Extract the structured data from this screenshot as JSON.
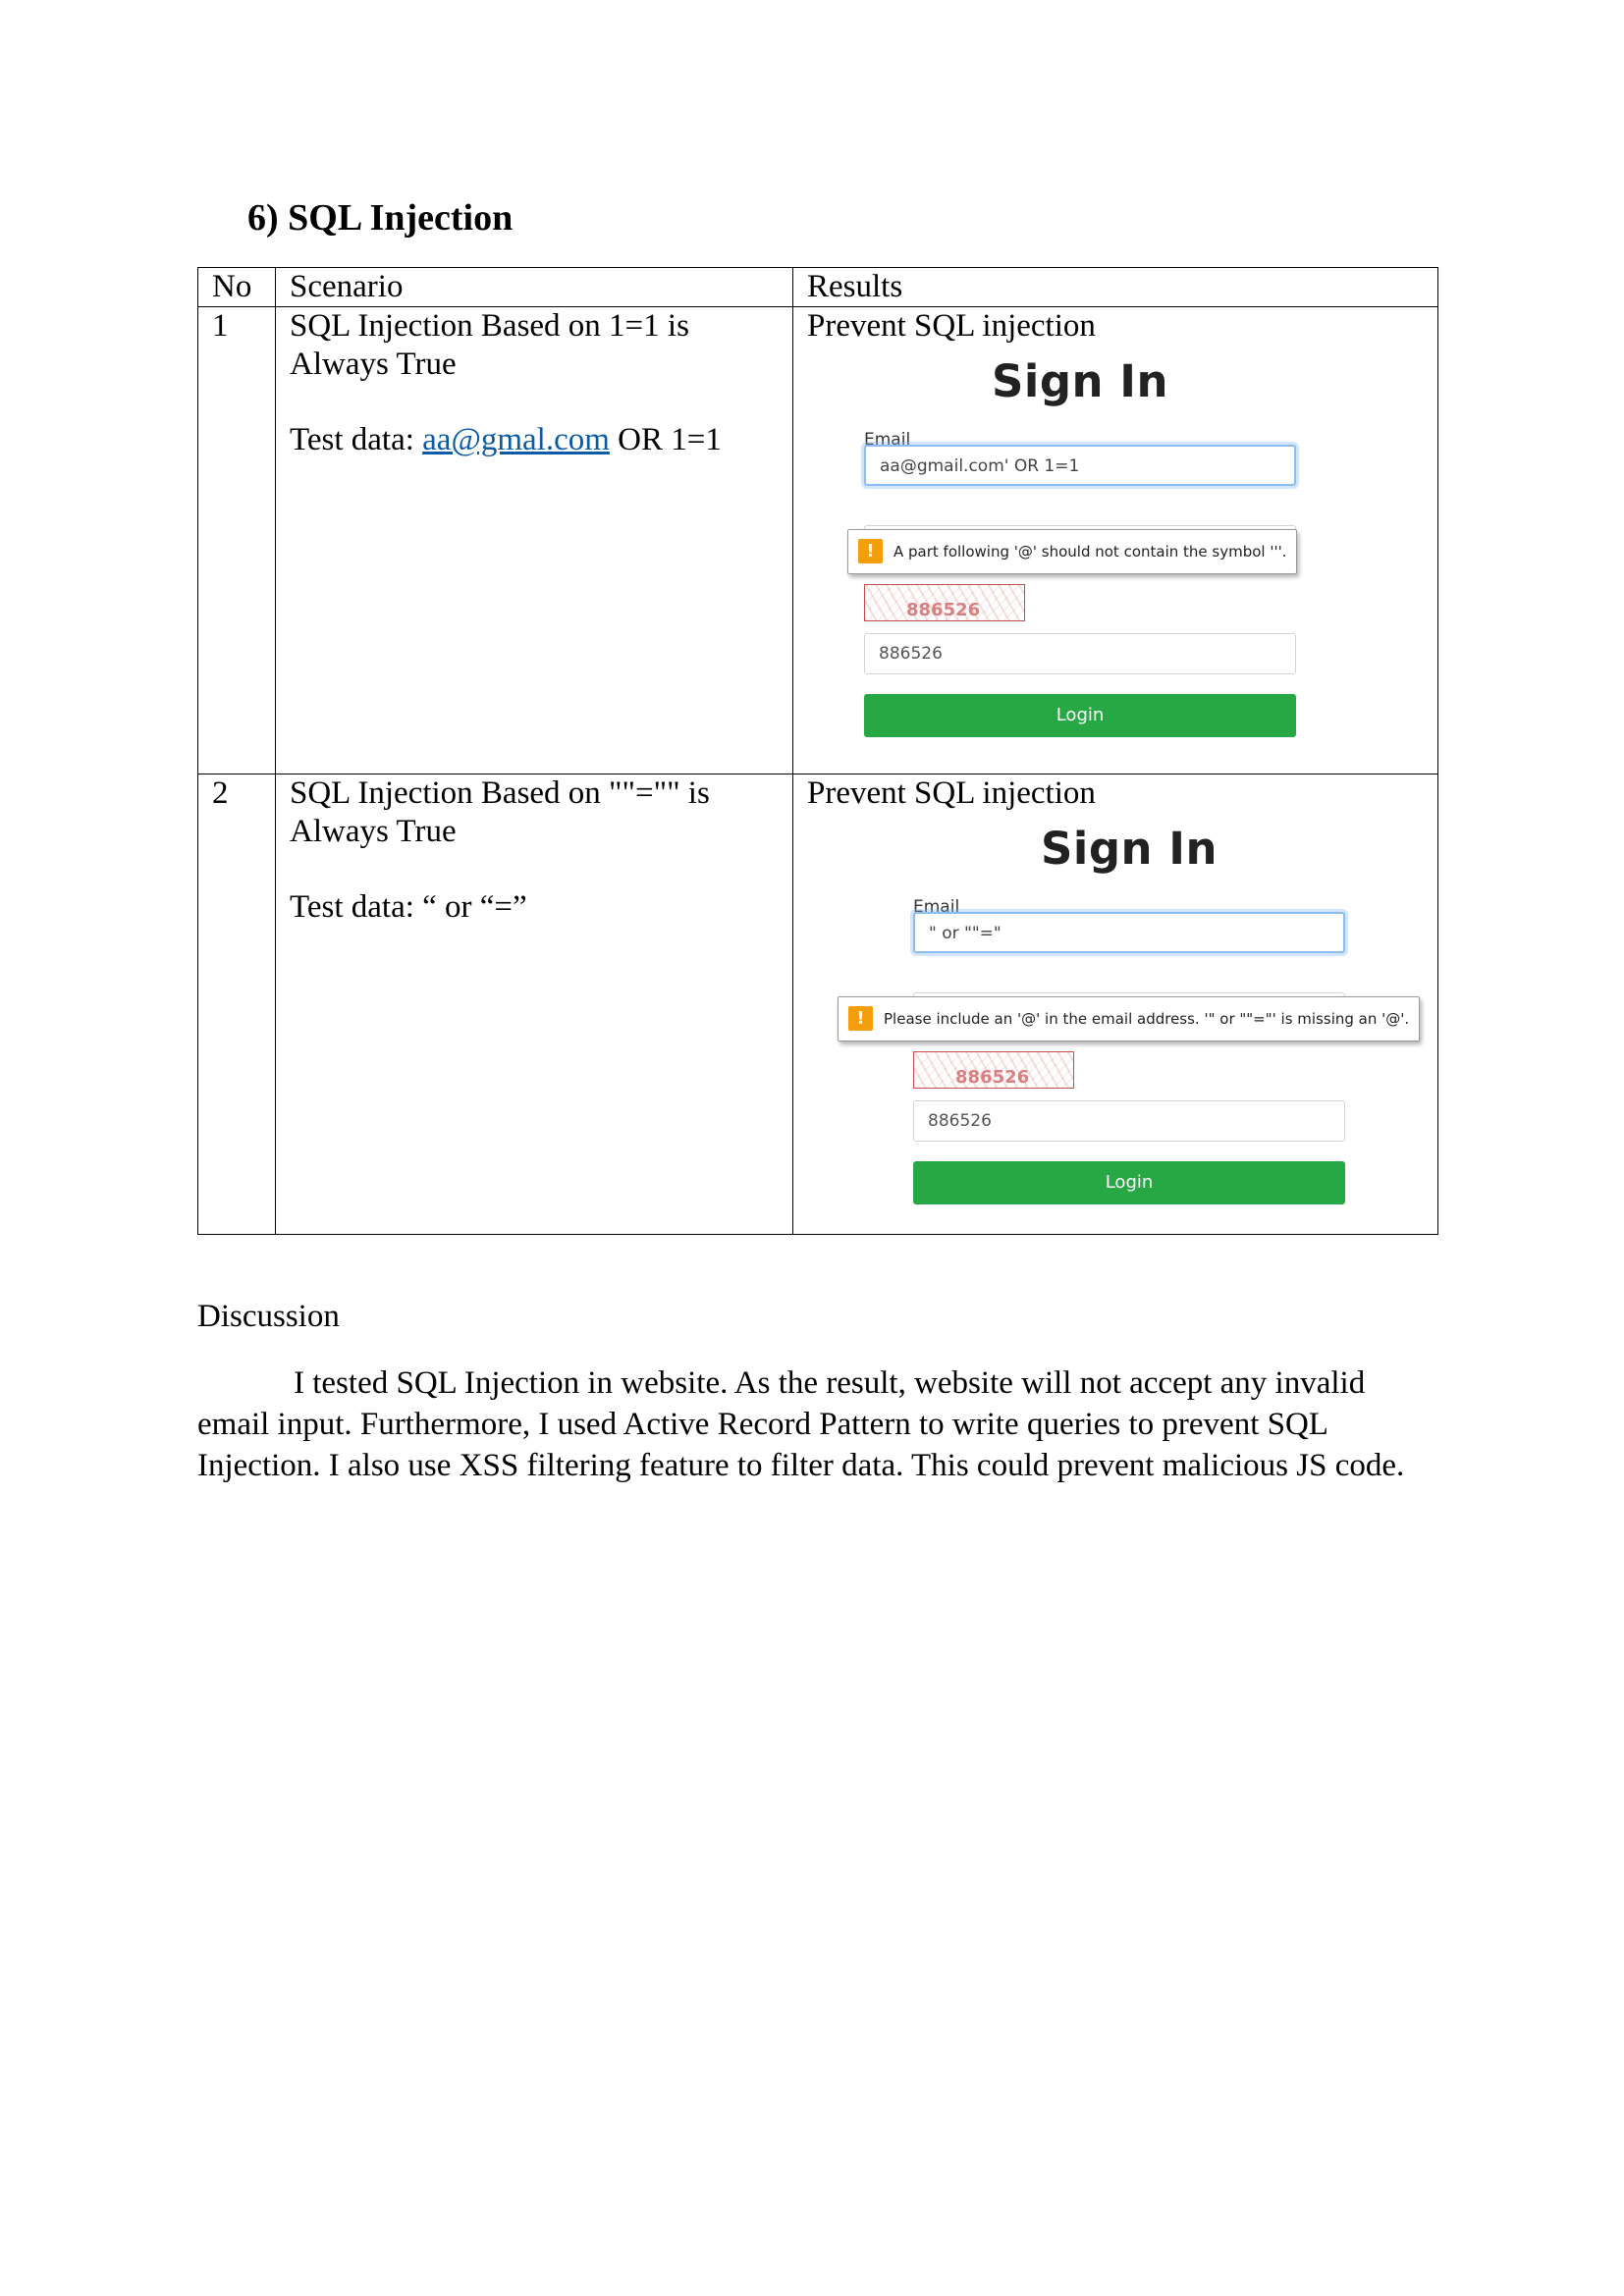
{
  "heading": "6)  SQL Injection",
  "table": {
    "headers": [
      "No",
      "Scenario",
      "Results"
    ],
    "rows": [
      {
        "no": "1",
        "scenario": "SQL Injection Based on 1=1 is Always True",
        "testdata_prefix": "Test data: ",
        "testdata_link": "aa@gmal.com",
        "testdata_suffix": " OR 1=1",
        "result": "Prevent SQL injection",
        "shot": {
          "title": "Sign In",
          "email_label": "Email",
          "email_value": "aa@gmail.com' OR 1=1",
          "tooltip": "A part following '@' should not contain the symbol '''.",
          "password_mask": "•••••••••",
          "captcha_text": "886526",
          "code_value": "886526",
          "login": "Login"
        }
      },
      {
        "no": "2",
        "scenario": "SQL Injection Based on \"\"=\"\" is Always True",
        "testdata": "Test data: “ or “=”",
        "result": "Prevent SQL injection",
        "shot": {
          "title": "Sign In",
          "email_label": "Email",
          "email_value": "\" or \"\"=\"",
          "tooltip": "Please include an '@' in the email address. '\" or \"\"=\"' is missing an '@'.",
          "password_mask": "•••••••••",
          "captcha_text": "886526",
          "code_value": "886526",
          "login": "Login"
        }
      }
    ]
  },
  "discussion": {
    "title": "Discussion",
    "body": "I tested SQL Injection in website. As the result, website will not accept any invalid email input. Furthermore, I used Active Record Pattern to write queries to prevent SQL Injection. I also use XSS filtering feature to filter data. This could prevent malicious JS code."
  }
}
